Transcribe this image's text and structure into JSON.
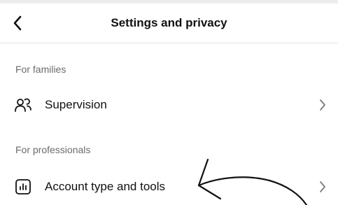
{
  "header": {
    "title": "Settings and privacy",
    "back_icon": "chevron-left-icon"
  },
  "sections": [
    {
      "label": "For families",
      "items": [
        {
          "label": "Supervision",
          "icon": "people-icon"
        }
      ]
    },
    {
      "label": "For professionals",
      "items": [
        {
          "label": "Account type and tools",
          "icon": "bar-chart-icon"
        }
      ]
    }
  ],
  "annotation": {
    "type": "hand-drawn-arrow",
    "points_to": "Account type and tools",
    "color": "#111111"
  },
  "colors": {
    "background": "#ffffff",
    "text": "#111111",
    "section_label": "#6b6b6b",
    "divider": "#e4e4e4",
    "chevron": "#7a7a7a"
  }
}
